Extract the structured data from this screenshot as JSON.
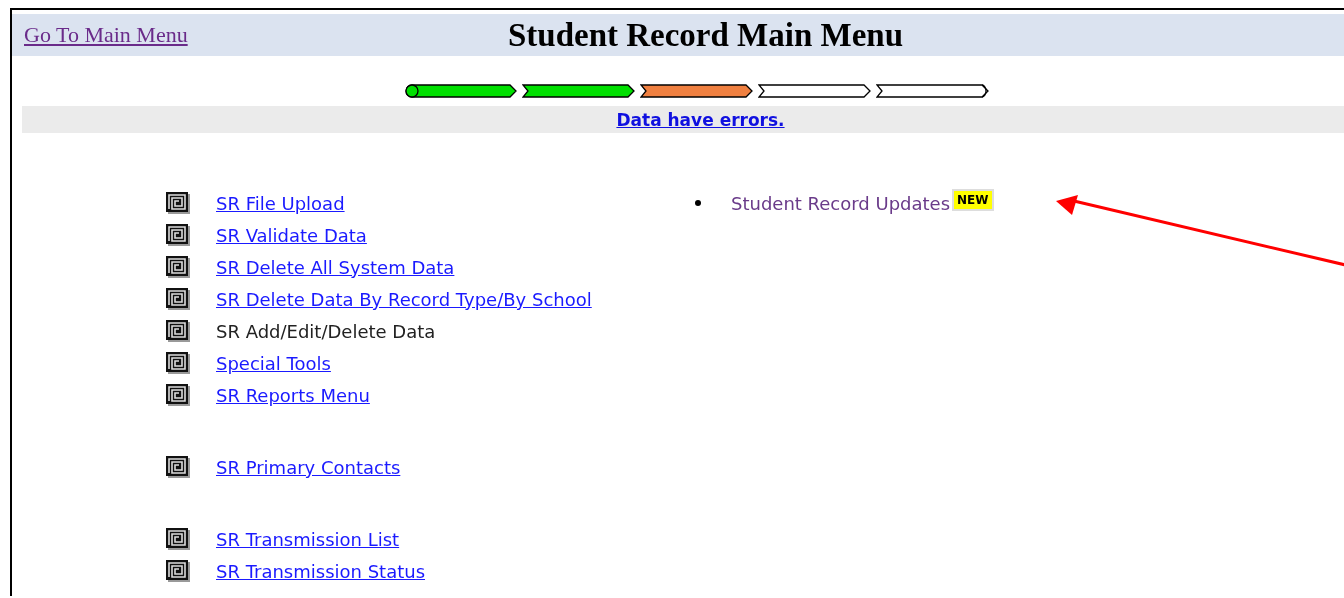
{
  "header": {
    "back_link": "Go To Main Menu",
    "title": "Student Record Main Menu"
  },
  "progress_steps": [
    {
      "done": true,
      "error": false
    },
    {
      "done": true,
      "error": false
    },
    {
      "done": false,
      "error": true
    },
    {
      "done": false,
      "error": false
    },
    {
      "done": false,
      "error": false
    }
  ],
  "status_message": "Data have errors.",
  "menu_groups": [
    {
      "items": [
        {
          "label": "SR File Upload",
          "kind": "link"
        },
        {
          "label": "SR Validate Data",
          "kind": "link"
        },
        {
          "label": "SR Delete All System Data",
          "kind": "link"
        },
        {
          "label": "SR Delete Data By Record Type/By School",
          "kind": "link"
        },
        {
          "label": "SR Add/Edit/Delete Data",
          "kind": "text"
        },
        {
          "label": "Special Tools",
          "kind": "link"
        },
        {
          "label": "SR Reports Menu",
          "kind": "link"
        }
      ]
    },
    {
      "items": [
        {
          "label": "SR Primary Contacts",
          "kind": "link"
        }
      ]
    },
    {
      "items": [
        {
          "label": "SR Transmission List",
          "kind": "link"
        },
        {
          "label": "SR Transmission Status",
          "kind": "link"
        }
      ]
    }
  ],
  "news": [
    {
      "label": "Student Record Updates",
      "badge": "NEW"
    }
  ]
}
